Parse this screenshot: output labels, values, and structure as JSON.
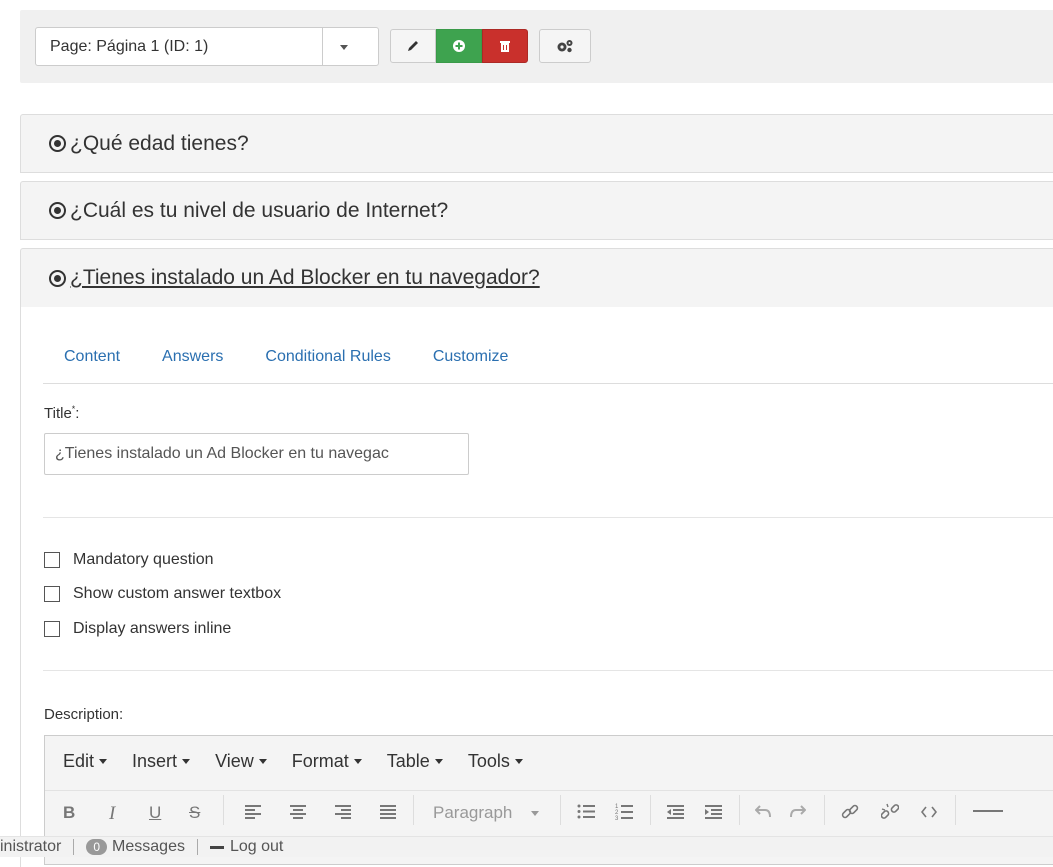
{
  "toolbar": {
    "page_select": "Page: Página 1 (ID: 1)",
    "icons": {
      "edit": "pencil-icon",
      "add": "plus-circle-icon",
      "delete": "trash-icon",
      "settings": "gears-icon"
    },
    "colors": {
      "add": "#3ea34f",
      "delete": "#c9302c"
    }
  },
  "questions": [
    {
      "title": "¿Qué edad tienes?"
    },
    {
      "title": "¿Cuál es tu nivel de usuario de Internet?"
    },
    {
      "title": "¿Tienes instalado un Ad Blocker en tu navegador?"
    }
  ],
  "tabs": [
    "Content",
    "Answers",
    "Conditional Rules",
    "Customize"
  ],
  "form": {
    "title_label": "Title",
    "required_mark": "*",
    "title_suffix": ":",
    "title_value": "¿Tienes instalado un Ad Blocker en tu navegac",
    "checkboxes": [
      "Mandatory question",
      "Show custom answer textbox",
      "Display answers inline"
    ],
    "description_label": "Description:"
  },
  "editor": {
    "menus": [
      "Edit",
      "Insert",
      "View",
      "Format",
      "Table",
      "Tools"
    ],
    "format": {
      "bold": "B",
      "italic": "I",
      "underline": "U",
      "strike": "S",
      "paragraph": "Paragraph"
    }
  },
  "statusbar": {
    "user": "inistrator",
    "messages_count": "0",
    "messages_label": "Messages",
    "logout_label": "Log out"
  }
}
